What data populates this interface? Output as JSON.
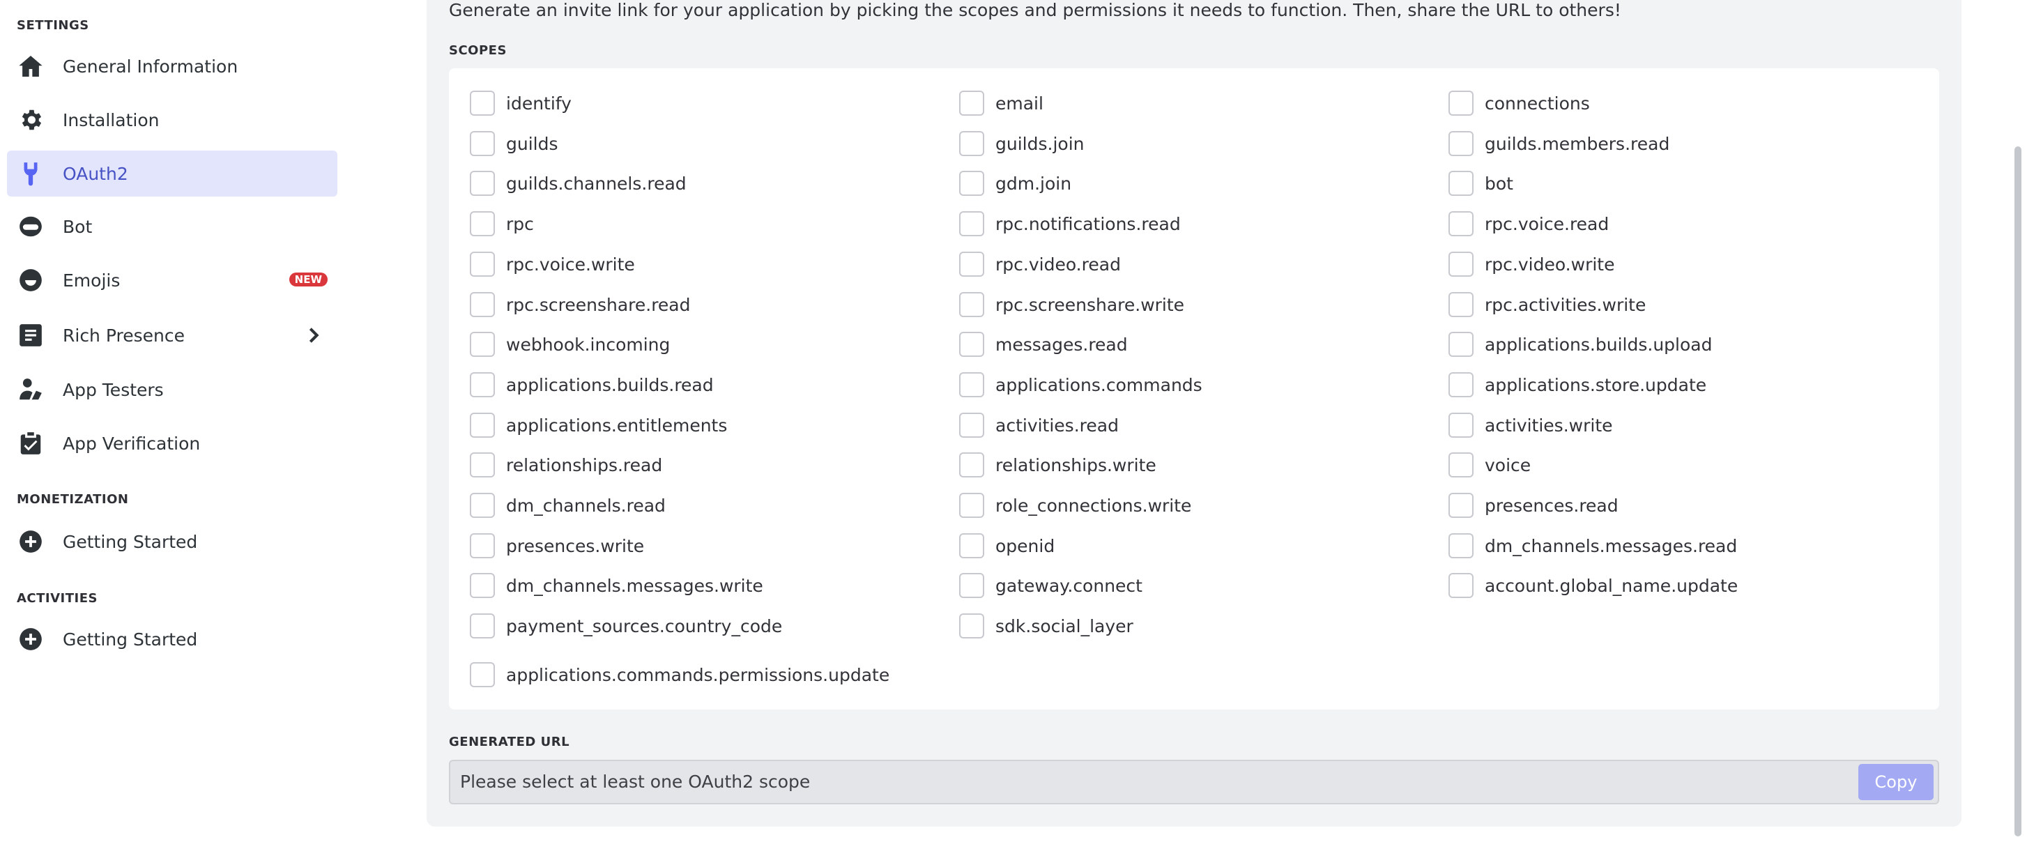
{
  "sidebar": {
    "settings_header": "SETTINGS",
    "settings_items": [
      {
        "label": "General Information",
        "icon": "home-icon"
      },
      {
        "label": "Installation",
        "icon": "gear-icon"
      },
      {
        "label": "OAuth2",
        "icon": "wrench-icon",
        "active": true
      },
      {
        "label": "Bot",
        "icon": "bot-icon"
      },
      {
        "label": "Emojis",
        "icon": "smile-icon",
        "badge": "NEW"
      },
      {
        "label": "Rich Presence",
        "icon": "document-icon",
        "expandable": true
      },
      {
        "label": "App Testers",
        "icon": "person-icon"
      },
      {
        "label": "App Verification",
        "icon": "clipboard-check-icon"
      }
    ],
    "monetization_header": "MONETIZATION",
    "monetization_items": [
      {
        "label": "Getting Started",
        "icon": "plus-circle-icon"
      }
    ],
    "activities_header": "ACTIVITIES",
    "activities_items": [
      {
        "label": "Getting Started",
        "icon": "plus-circle-icon"
      }
    ]
  },
  "main": {
    "intro": "Generate an invite link for your application by picking the scopes and permissions it needs to function. Then, share the URL to others!",
    "scopes_header": "SCOPES",
    "scopes": [
      [
        "identify",
        "email",
        "connections"
      ],
      [
        "guilds",
        "guilds.join",
        "guilds.members.read"
      ],
      [
        "guilds.channels.read",
        "gdm.join",
        "bot"
      ],
      [
        "rpc",
        "rpc.notifications.read",
        "rpc.voice.read"
      ],
      [
        "rpc.voice.write",
        "rpc.video.read",
        "rpc.video.write"
      ],
      [
        "rpc.screenshare.read",
        "rpc.screenshare.write",
        "rpc.activities.write"
      ],
      [
        "webhook.incoming",
        "messages.read",
        "applications.builds.upload"
      ],
      [
        "applications.builds.read",
        "applications.commands",
        "applications.store.update"
      ],
      [
        "applications.entitlements",
        "activities.read",
        "activities.write"
      ],
      [
        "relationships.read",
        "relationships.write",
        "voice"
      ],
      [
        "dm_channels.read",
        "role_connections.write",
        "presences.read"
      ],
      [
        "presences.write",
        "openid",
        "dm_channels.messages.read"
      ],
      [
        "dm_channels.messages.write",
        "gateway.connect",
        "account.global_name.update"
      ],
      [
        "payment_sources.country_code",
        "sdk.social_layer"
      ]
    ],
    "extra_scope": "applications.commands.permissions.update",
    "generated_url_header": "GENERATED URL",
    "generated_url_placeholder": "Please select at least one OAuth2 scope",
    "copy_label": "Copy"
  },
  "colors": {
    "accent": "#5865f2",
    "active_bg": "#e3e5fc",
    "badge": "#da373c",
    "copy_disabled": "#a3aaf3",
    "panel_bg": "#f2f3f5"
  }
}
